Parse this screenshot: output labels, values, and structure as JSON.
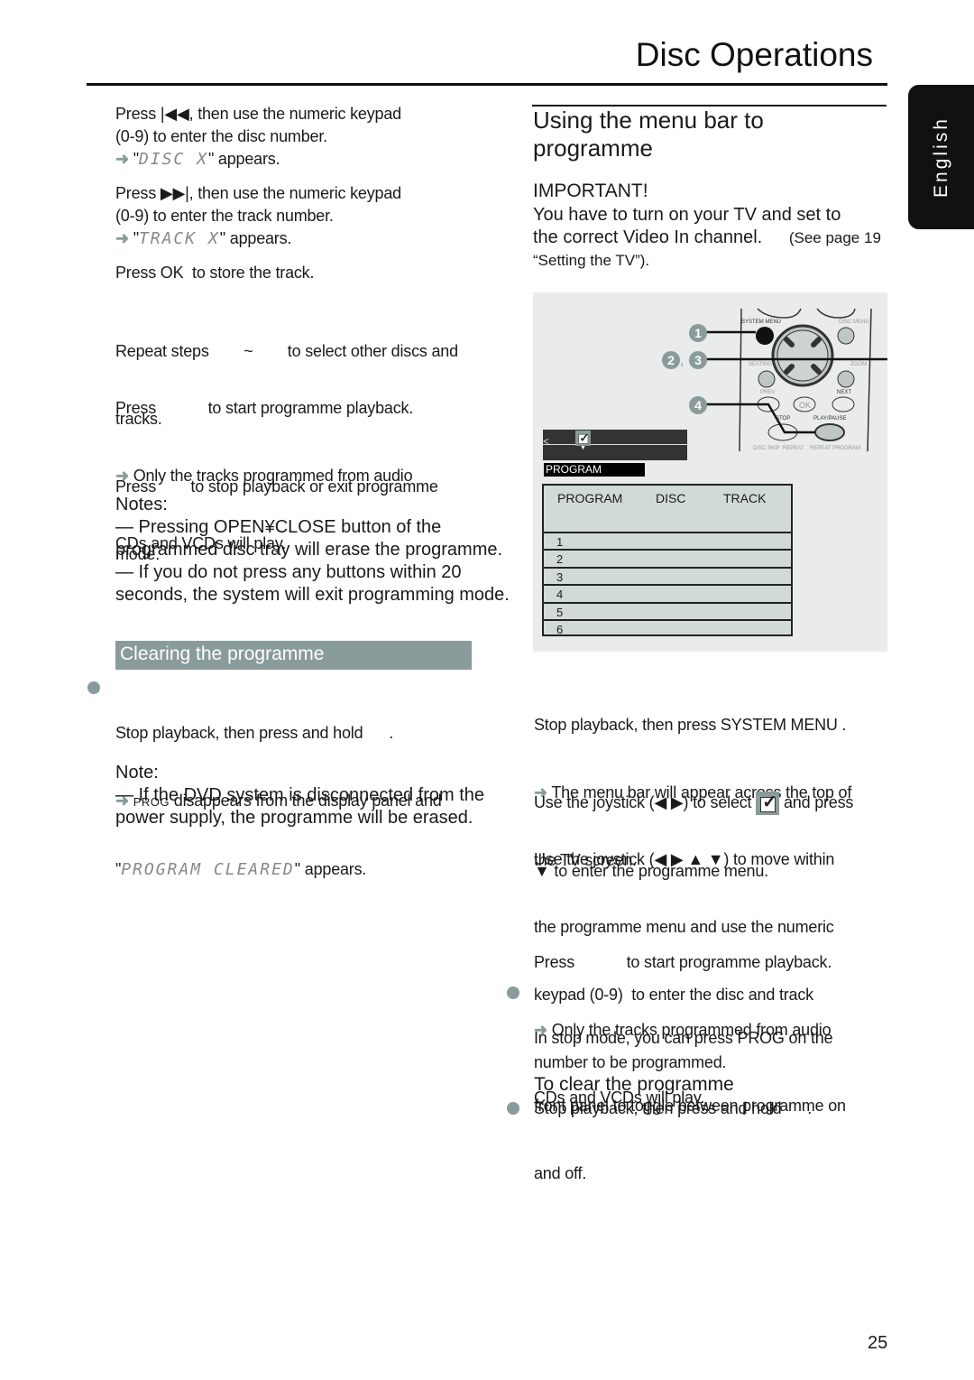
{
  "header": {
    "title": "Disc Operations",
    "language_tab": "English",
    "page_number": "25"
  },
  "left": {
    "step1": {
      "press": "Press",
      "icon": "prev-icon",
      "text": ", then use the numeric keypad",
      "line2": "(0-9)  to enter the disc number.",
      "arrow": "➜",
      "quote_open": "\"",
      "lcd": "DISC X",
      "result": "\" appears."
    },
    "step2": {
      "press": "Press",
      "icon": "next-icon",
      "text": ", then use the numeric keypad",
      "line2": "(0-9)  to enter the track number.",
      "arrow": "➜",
      "quote_open": "\"",
      "lcd": "TRACK X",
      "result": "\" appears."
    },
    "step3": "Press OK  to store the track.",
    "step4": {
      "line1": "Repeat steps        ~        to select other discs and",
      "line2": "tracks."
    },
    "step5": {
      "line1": "Press            to start programme playback.",
      "arrow": "➜",
      "line2": " Only the tracks programmed from audio",
      "line3": "CDs and VCDs will play."
    },
    "step6": {
      "line1": "Press        to stop playback or exit programme",
      "line2": "mode."
    },
    "notes": {
      "heading": "Notes:",
      "lines": [
        "—  Pressing OPEN¥CLOSE button of the",
        "programmed disc tray will erase the programme.",
        "—  If you do not press any buttons within 20",
        "seconds, the system will exit programming mode."
      ]
    },
    "clearing": {
      "heading": "Clearing the programme",
      "bullet_text": "Stop playback, then press and hold      .",
      "arrow": "➜",
      "prog": "PROG",
      "line2": " disappears from the display panel and",
      "quote_open": "\"",
      "lcd": "PROGRAM CLEARED",
      "result": "\" appears.",
      "note_heading": "Note:",
      "note_lines": [
        "—  If the DVD system is disconnected from the",
        "power supply, the programme will be erased."
      ]
    }
  },
  "right": {
    "heading_line1": "Using the menu bar to",
    "heading_line2": "programme",
    "important": "IMPORTANT!",
    "important_lines": [
      "You have to turn on your TV and set to",
      "the correct Video In channel."
    ],
    "see_page": "(See page 19",
    "see_page2": "“Setting the TV”).",
    "figure": {
      "callouts": [
        "1",
        "2",
        "3",
        "4"
      ],
      "callout_sep": ",",
      "remote_labels": {
        "system_menu": "SYSTEM MENU",
        "disc_menu": "DISC MENU",
        "seating": "SEATING",
        "zoom": "ZOOM",
        "prev": "PREV",
        "next": "NEXT",
        "ok": "OK",
        "stop": "STOP",
        "play_pause": "PLAY/PAUSE",
        "bottom": "DISC SKIP  REPEAT    REPEAT PROGRAM"
      },
      "program_label": "PROGRAM",
      "table": {
        "headers": [
          "PROGRAM",
          "DISC",
          "TRACK"
        ],
        "rows": [
          "1",
          "2",
          "3",
          "4",
          "5",
          "6"
        ]
      }
    },
    "step1": {
      "line1": "Stop playback, then press SYSTEM MENU .",
      "arrow": "➜",
      "line2": " The menu bar will appear across the top of",
      "line3": "the TV screen."
    },
    "step2": {
      "pre": "Use the joystick (◀ ▶) to select ",
      "post": " and press",
      "line2": "▼ to enter the programme menu."
    },
    "step3": [
      "Use the joystick (◀ ▶ ▲ ▼) to move within",
      "the programme menu and use the numeric",
      "keypad (0-9)  to enter the disc and track",
      "number to be programmed."
    ],
    "step4": {
      "line1": "Press            to start programme playback.",
      "arrow": "➜",
      "line2": " Only the tracks programmed from audio",
      "line3": "CDs and VCDs will play."
    },
    "bullet1": [
      "In stop mode, you can press PROG on the",
      "front panel to toggle between programme on",
      "and off."
    ],
    "clear_heading": "To clear the programme",
    "bullet2": "Stop playback, then press and hold      ."
  }
}
